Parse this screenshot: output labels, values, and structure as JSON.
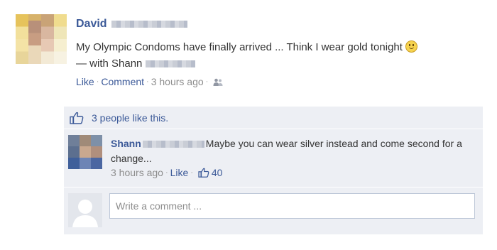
{
  "post": {
    "author": "David",
    "text": "My Olympic Condoms have finally arrived ... Think I wear gold tonight",
    "with_label": "— with Shann",
    "actions": {
      "like": "Like",
      "comment": "Comment",
      "time": "3 hours ago"
    }
  },
  "likes": {
    "text": "3 people like this."
  },
  "comment": {
    "author": "Shann",
    "text": "Maybe you can wear silver instead and come second for a change...",
    "time": "3 hours ago",
    "like": "Like",
    "like_count": "40"
  },
  "composer": {
    "placeholder": "Write a comment ..."
  },
  "colors": {
    "link": "#3b5998",
    "feedback_bg": "#edeff4",
    "input_border": "#bdc7d8"
  }
}
